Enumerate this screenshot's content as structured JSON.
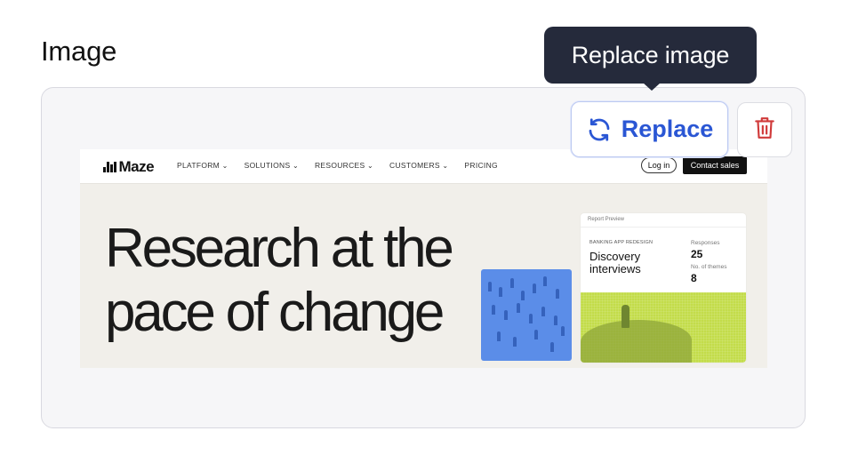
{
  "field": {
    "label": "Image"
  },
  "tooltip": {
    "text": "Replace image"
  },
  "actions": {
    "replace_label": "Replace",
    "replace_icon": "refresh-icon",
    "delete_icon": "trash-icon",
    "accent_color": "#2a56d4",
    "danger_color": "#d03a3a"
  },
  "preview": {
    "logo": "Maze",
    "nav": [
      "PLATFORM",
      "SOLUTIONS",
      "RESOURCES",
      "CUSTOMERS",
      "PRICING"
    ],
    "login": "Log in",
    "contact": "Contact sales",
    "headline_line1": "Research at the",
    "headline_line2": "pace of change",
    "report": {
      "title": "Report Preview",
      "kicker": "BANKING APP REDESIGN",
      "name_line1": "Discovery",
      "name_line2": "interviews",
      "stat1_label": "Responses",
      "stat1_value": "25",
      "stat2_label": "No. of themes",
      "stat2_value": "8"
    }
  }
}
